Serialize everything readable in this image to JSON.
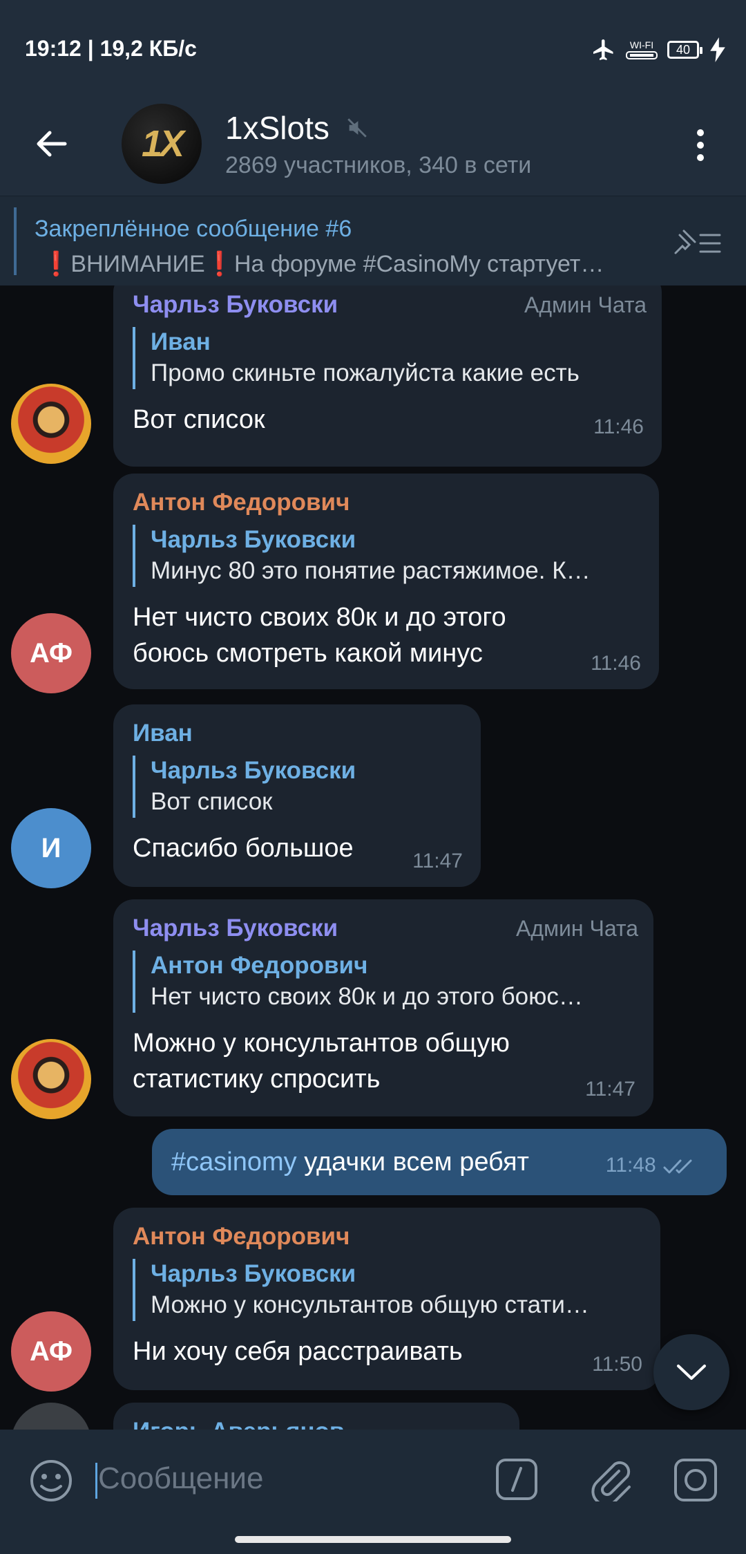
{
  "status": {
    "time": "19:12 | 19,2 КБ/с",
    "wifi": "WI-FI",
    "battery": "40"
  },
  "header": {
    "avatar_text": "1X",
    "title": "1xSlots",
    "subtitle": "2869 участников, 340 в сети"
  },
  "pinned": {
    "title": "Закреплённое сообщение #6",
    "text": "❗ВНИМАНИЕ❗На форуме #CasinoMy стартует…"
  },
  "messages": [
    {
      "author": "Чарльз Буковски",
      "role": "Админ Чата",
      "reply_name": "Иван",
      "reply_text": "Промо скиньте пожалуйста какие есть",
      "text": "Вот список",
      "time": "11:46"
    },
    {
      "author": "Антон Федорович",
      "role": "",
      "reply_name": "Чарльз Буковски",
      "reply_text": "Минус 80 это понятие растяжимое. К…",
      "text_line1": "Нет чисто своих 80к и до этого",
      "text_line2": "боюсь смотреть какой минус",
      "time": "11:46"
    },
    {
      "author": "Иван",
      "reply_name": "Чарльз Буковски",
      "reply_text": "Вот список",
      "text": "Спасибо большое",
      "time": "11:47"
    },
    {
      "author": "Чарльз Буковски",
      "role": "Админ Чата",
      "reply_name": "Антон Федорович",
      "reply_text": "Нет чисто своих 80к и до этого боюс…",
      "text_line1": "Можно у консультантов общую",
      "text_line2": "статистику спросить",
      "time": "11:47"
    },
    {
      "hashtag": "#casinomy",
      "text": "удачки всем ребят",
      "time": "11:48"
    },
    {
      "author": "Антон Федорович",
      "reply_name": "Чарльз Буковски",
      "reply_text": "Можно у консультантов общую стати…",
      "text": "Ни хочу себя расстраивать",
      "time": "11:50"
    },
    {
      "author": "Игорь Аверьянов"
    }
  ],
  "avatars": {
    "af": "АФ",
    "i": "И"
  },
  "input": {
    "placeholder": "Сообщение"
  },
  "colors": {
    "header_bg": "#212d3b",
    "incoming_bubble": "#1c242f",
    "outgoing_bubble": "#2b5278",
    "link_blue": "#6eb0e4",
    "name_purple": "#8e8ef0",
    "name_orange": "#e0895a"
  }
}
